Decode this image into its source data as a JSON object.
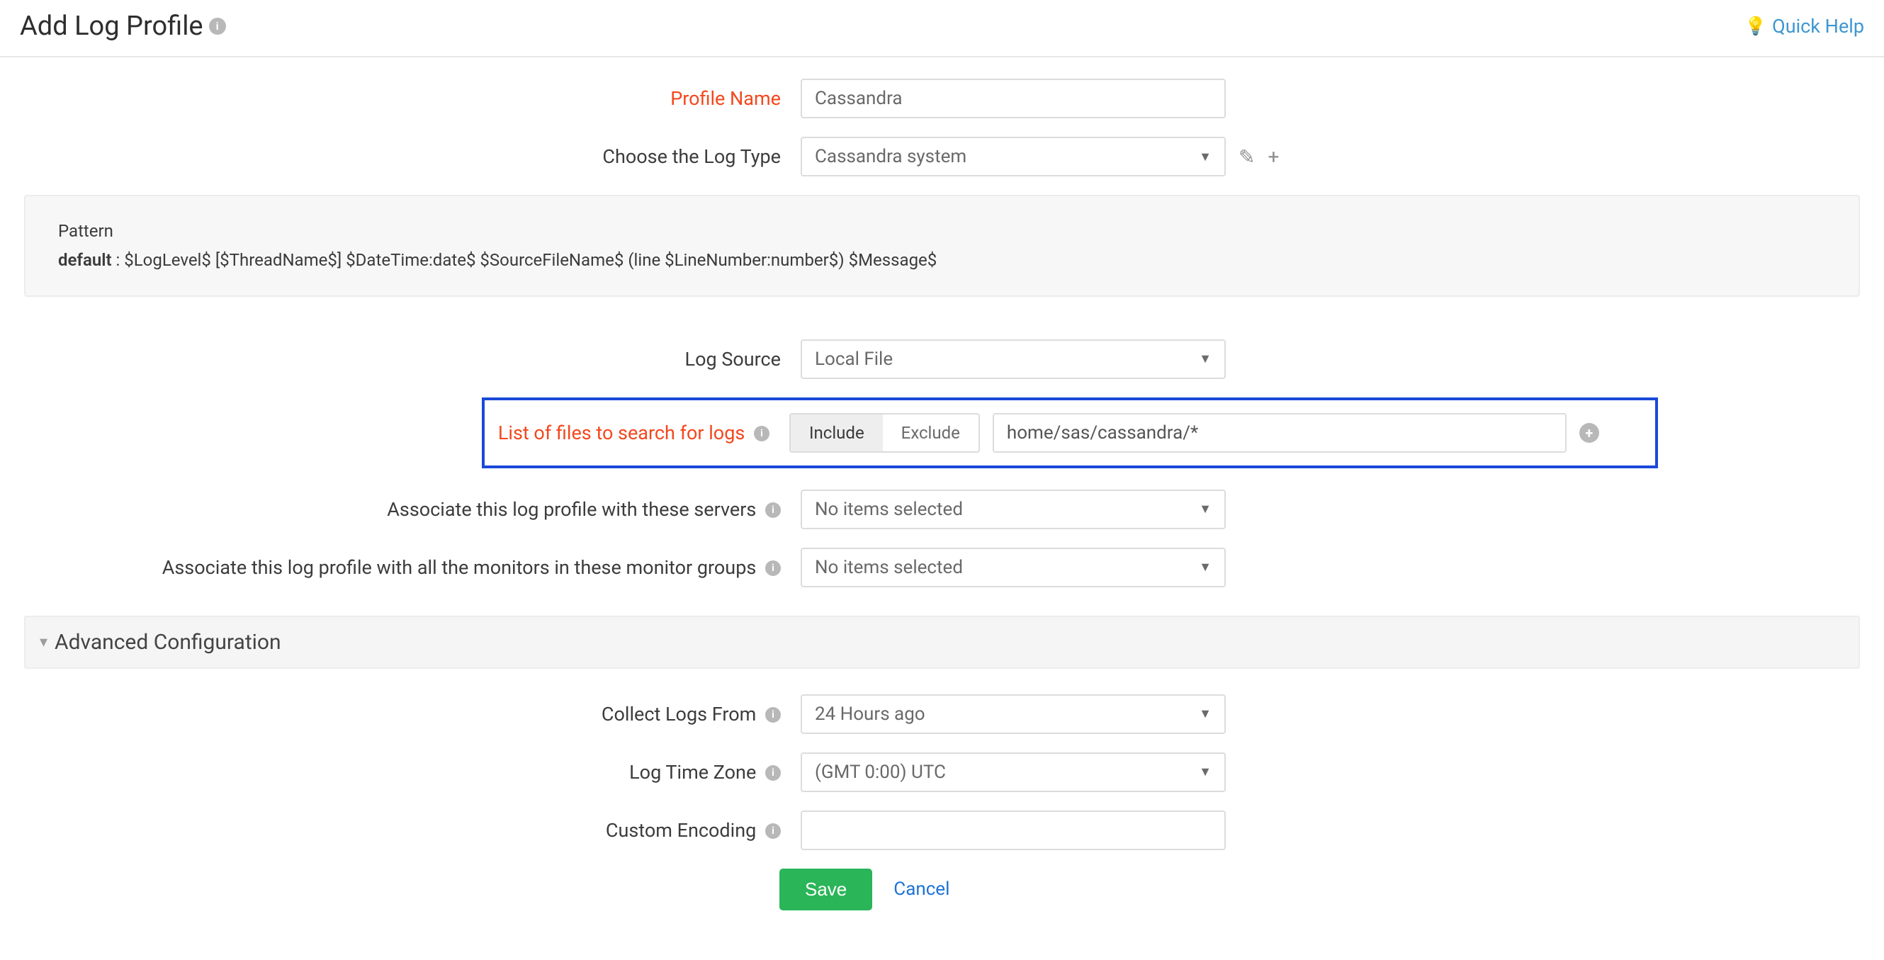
{
  "header": {
    "title": "Add Log Profile",
    "quick_help": "Quick Help"
  },
  "form": {
    "profile_name": {
      "label": "Profile Name",
      "value": "Cassandra"
    },
    "log_type": {
      "label": "Choose the Log Type",
      "value": "Cassandra system"
    },
    "pattern": {
      "title": "Pattern",
      "default_label": "default",
      "default_value": "$LogLevel$ [$ThreadName$] $DateTime:date$ $SourceFileName$ (line $LineNumber:number$) $Message$"
    },
    "log_source": {
      "label": "Log Source",
      "value": "Local File"
    },
    "file_list": {
      "label": "List of files to search for logs",
      "include": "Include",
      "exclude": "Exclude",
      "path": "home/sas/cassandra/*"
    },
    "assoc_servers": {
      "label": "Associate this log profile with these servers",
      "value": "No items selected"
    },
    "assoc_groups": {
      "label": "Associate this log profile with all the monitors in these monitor groups",
      "value": "No items selected"
    },
    "advanced": {
      "title": "Advanced Configuration",
      "collect_from": {
        "label": "Collect Logs From",
        "value": "24 Hours ago"
      },
      "timezone": {
        "label": "Log Time Zone",
        "value": "(GMT 0:00) UTC"
      },
      "encoding": {
        "label": "Custom Encoding",
        "value": ""
      }
    },
    "actions": {
      "save": "Save",
      "cancel": "Cancel"
    }
  }
}
